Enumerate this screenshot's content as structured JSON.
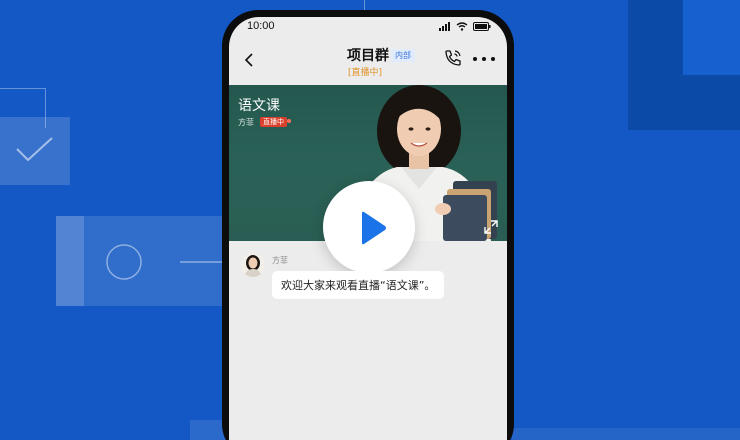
{
  "status_bar": {
    "time": "10:00"
  },
  "header": {
    "title": "项目群",
    "tag": "内部",
    "live_status": "[直播中]",
    "back_icon": "chevron-left-icon",
    "call_icon": "phone-icon",
    "more_icon": "more-dots-icon"
  },
  "video": {
    "title": "语文课",
    "host": "方菲",
    "live_badge": "直播中",
    "play_icon": "play-icon",
    "expand_icon": "expand-icon"
  },
  "chat": {
    "messages": [
      {
        "sender": "方菲",
        "text": "欢迎大家来观看直播“语文课”。"
      }
    ]
  },
  "colors": {
    "background": "#1358c4",
    "accent_blue": "#1a73e8",
    "live_orange": "#e0932b",
    "live_red": "#d9402d"
  }
}
